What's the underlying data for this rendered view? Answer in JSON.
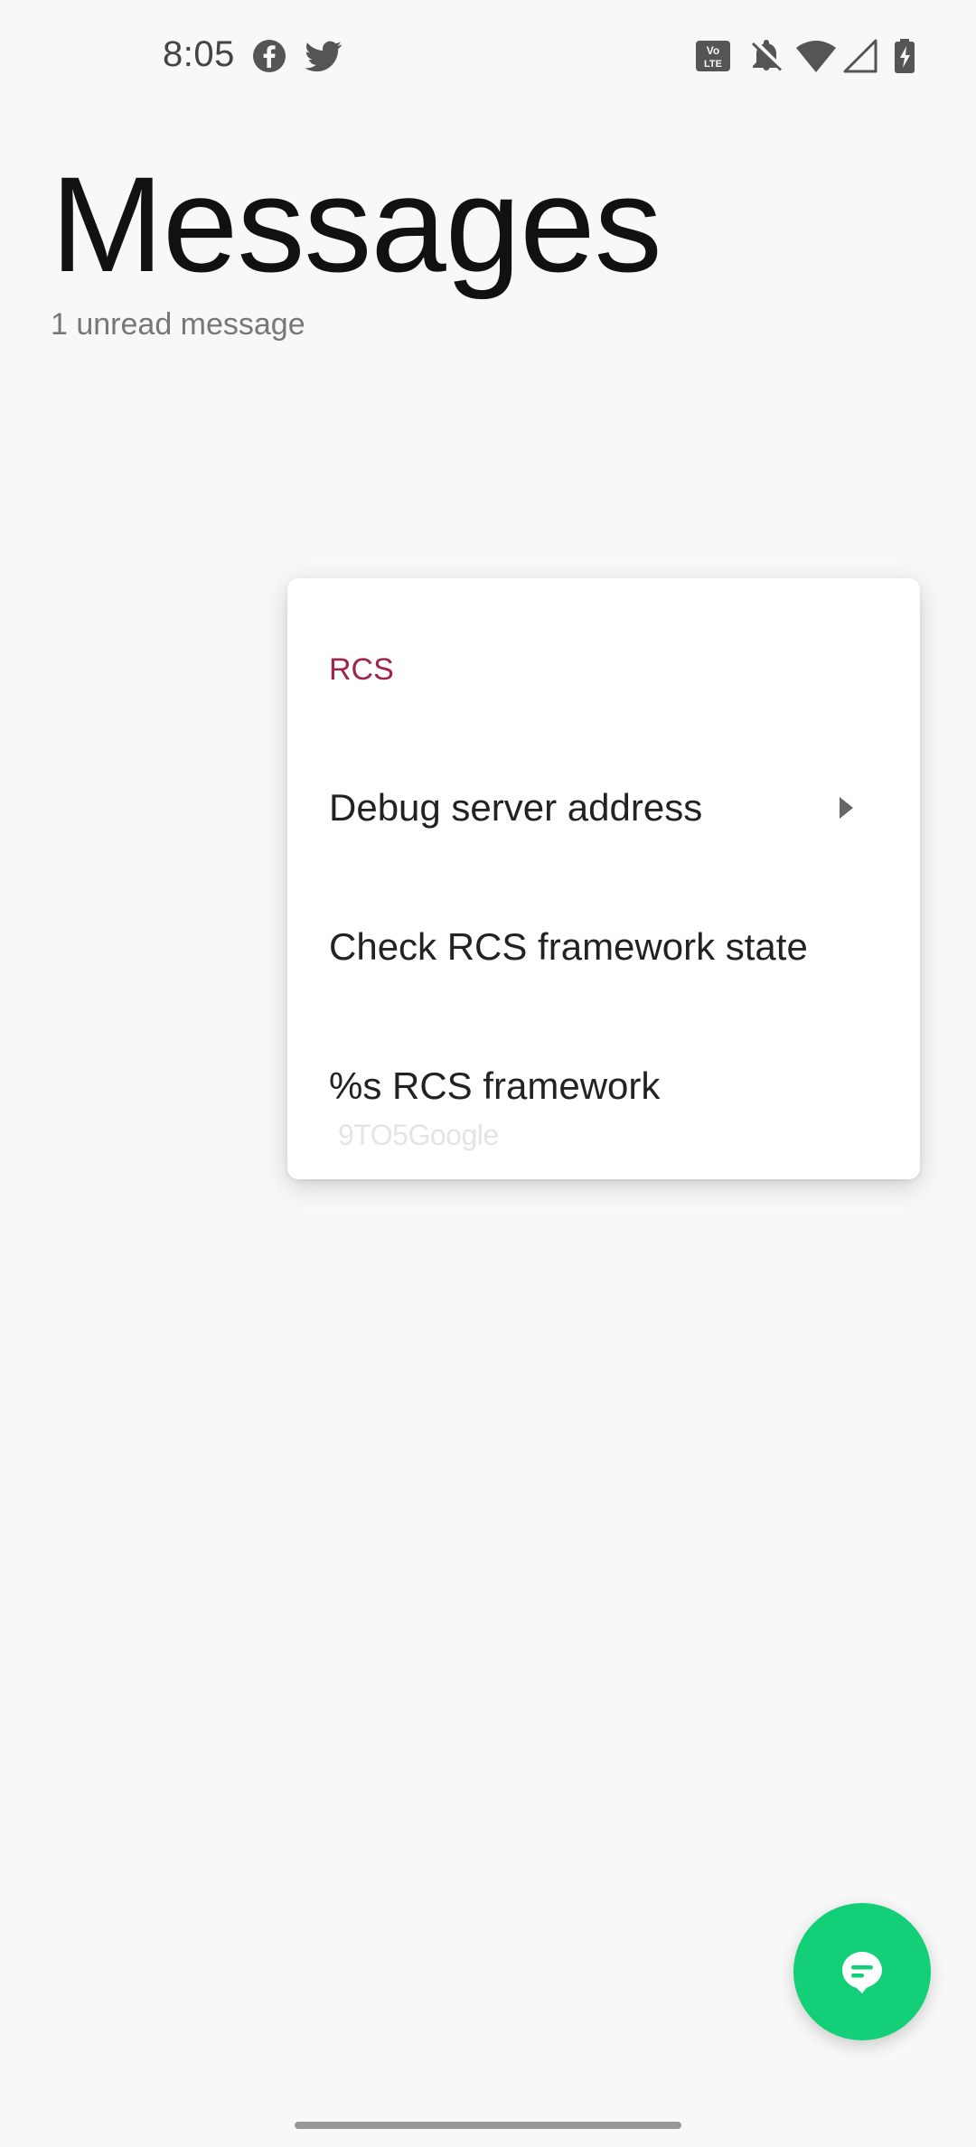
{
  "status_bar": {
    "time": "8:05",
    "left_icons": [
      "facebook-icon",
      "twitter-icon"
    ],
    "right_icons": [
      "volte-icon",
      "bell-off-icon",
      "wifi-icon",
      "signal-icon",
      "battery-charging-icon"
    ],
    "volte_text": "Vo LTE"
  },
  "header": {
    "title": "Messages",
    "subtitle": "1 unread message"
  },
  "menu": {
    "section_header": "RCS",
    "items": [
      {
        "label": "Debug server address",
        "has_submenu": true
      },
      {
        "label": "Check RCS framework state",
        "has_submenu": false
      },
      {
        "label": "%s RCS framework",
        "has_submenu": false
      }
    ],
    "watermark": "9TO5Google"
  },
  "fab": {
    "icon": "chat-bubble-icon",
    "color": "#12cf78"
  },
  "colors": {
    "accent": "#a1234b",
    "background": "#f8f8f8"
  }
}
